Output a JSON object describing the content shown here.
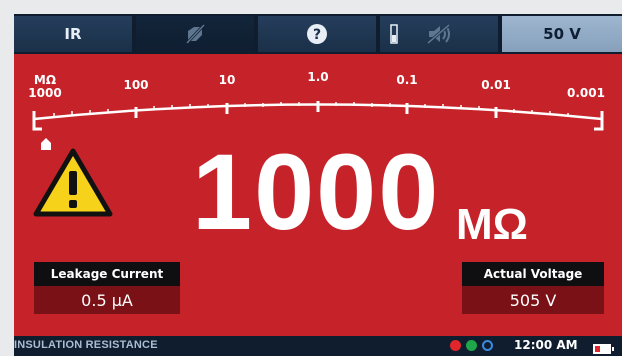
{
  "toolbar": {
    "mode_label": "IR",
    "voltage_label": "50 V",
    "icons": [
      "cable-off-icon",
      "help-icon",
      "battery-level-icon",
      "sound-off-icon"
    ]
  },
  "scale": {
    "unit_label": "MΩ",
    "ticks": [
      "1000",
      "100",
      "10",
      "1.0",
      "0.1",
      "0.01",
      "0.001"
    ],
    "pointer_value": "1000"
  },
  "reading": {
    "value": "1000",
    "unit": "MΩ",
    "warning_icon": "warning-triangle-icon"
  },
  "leakage": {
    "label": "Leakage Current",
    "value": "0.5 µA"
  },
  "actual_voltage": {
    "label": "Actual Voltage",
    "value": "505 V"
  },
  "status": {
    "title": "INSULATION RESISTANCE",
    "indicators": [
      {
        "name": "red-indicator",
        "color": "#e0262c"
      },
      {
        "name": "green-indicator",
        "color": "#1fa64a"
      },
      {
        "name": "blue-indicator",
        "color": "#3a8be0"
      }
    ],
    "time": "12:00 AM",
    "battery_icon": "battery-icon"
  },
  "colors": {
    "panel": "#c62229",
    "toolbar": "#0f1d2e",
    "warning": "#f7d21a"
  }
}
